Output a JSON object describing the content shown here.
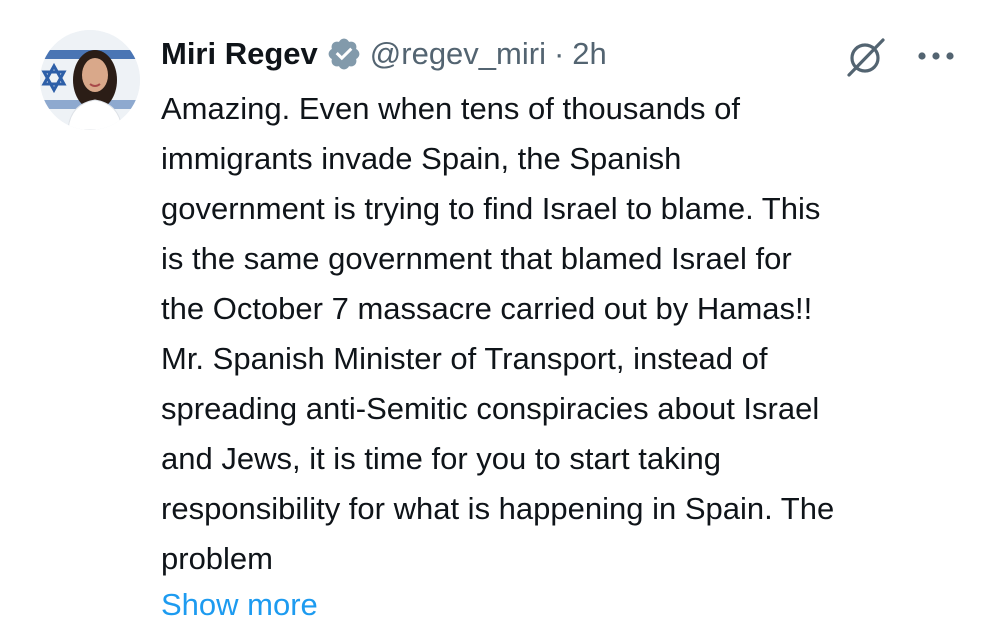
{
  "tweet": {
    "display_name": "Miri Regev",
    "handle": "@regev_miri",
    "separator": "·",
    "timestamp": "2h",
    "verified_badge_icon": "verified-badge-icon",
    "grok_icon": "grok-icon",
    "more_icon": "more-options-icon",
    "text_lines": [
      "Amazing. Even when tens of thousands of",
      "immigrants invade Spain, the Spanish",
      "government is trying to find Israel to blame. This",
      "is the same government that blamed Israel for",
      "the October 7 massacre carried out by Hamas!!",
      "Mr. Spanish Minister of Transport, instead of",
      "spreading anti-Semitic conspiracies about Israel",
      "and Jews, it is time for you to start taking",
      "responsibility for what is happening in Spain. The",
      "problem"
    ],
    "show_more_label": "Show more"
  },
  "colors": {
    "text_primary": "#0f1419",
    "text_secondary": "#536471",
    "link": "#1d9bf0",
    "badge": "#829aab",
    "background": "#ffffff"
  }
}
